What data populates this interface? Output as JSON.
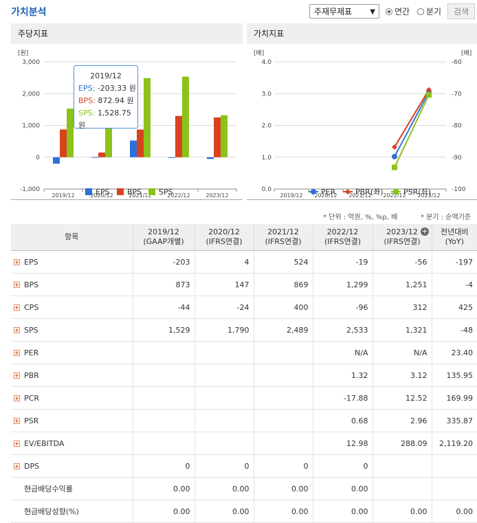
{
  "header": {
    "title": "가치분석",
    "select_value": "주재무제표",
    "radio_annual": "연간",
    "radio_quarter": "분기",
    "search_button": "검색"
  },
  "left_panel": {
    "title": "주당지표",
    "y_unit": "[원]",
    "tooltip": {
      "period": "2019/12",
      "eps_label": "EPS:",
      "eps_value": "-203.33 원",
      "bps_label": "BPS:",
      "bps_value": "872.94 원",
      "sps_label": "SPS:",
      "sps_value": "1,528.75 원"
    }
  },
  "right_panel": {
    "title": "가치지표",
    "y_unit_left": "[배]",
    "y_unit_right": "[배]"
  },
  "chart_data": [
    {
      "type": "bar",
      "title": "주당지표",
      "ylabel": "[원]",
      "categories": [
        "2019/12",
        "2020/12",
        "2021/12",
        "2022/12",
        "2023/12"
      ],
      "ylim": [
        -1000,
        3000
      ],
      "yticks": [
        "3,000",
        "2,000",
        "1,000",
        "0",
        "-1,000"
      ],
      "series": [
        {
          "name": "EPS",
          "color": "#2f6fd8",
          "values": [
            -203,
            4,
            524,
            -19,
            -56
          ]
        },
        {
          "name": "BPS",
          "color": "#d8431f",
          "values": [
            873,
            147,
            869,
            1299,
            1251
          ]
        },
        {
          "name": "SPS",
          "color": "#8cc21b",
          "values": [
            1529,
            1790,
            2489,
            2533,
            1321
          ]
        }
      ],
      "legend_position": "bottom"
    },
    {
      "type": "line",
      "title": "가치지표",
      "categories": [
        "2019/12",
        "2020/12",
        "2021/12",
        "2022/12",
        "2023/12"
      ],
      "ylim_left": [
        0,
        4
      ],
      "yticks_left": [
        "4.0",
        "3.0",
        "2.0",
        "1.0",
        "0.0"
      ],
      "ylim_right": [
        -100,
        -60
      ],
      "yticks_right": [
        "-60",
        "-70",
        "-80",
        "-90",
        "-100"
      ],
      "series": [
        {
          "name": "PER",
          "color": "#2f6fd8",
          "axis": "right",
          "values": [
            null,
            null,
            null,
            -89.8,
            -69.5
          ]
        },
        {
          "name": "PBR(좌)",
          "color": "#d8431f",
          "axis": "left",
          "values": [
            null,
            null,
            null,
            1.32,
            3.12
          ]
        },
        {
          "name": "PSR(좌)",
          "color": "#8cc21b",
          "axis": "left",
          "values": [
            null,
            null,
            null,
            0.68,
            2.96
          ]
        }
      ],
      "legend_position": "bottom"
    }
  ],
  "notes": {
    "unit": "* 단위 : 억원, %, %p, 배",
    "quarter": "* 분기 : 순액기준"
  },
  "table": {
    "headers": [
      {
        "line1": "항목",
        "line2": ""
      },
      {
        "line1": "2019/12",
        "line2": "(GAAP개별)"
      },
      {
        "line1": "2020/12",
        "line2": "(IFRS연결)"
      },
      {
        "line1": "2021/12",
        "line2": "(IFRS연결)"
      },
      {
        "line1": "2022/12",
        "line2": "(IFRS연결)"
      },
      {
        "line1": "2023/12",
        "line2": "(IFRS연결)"
      },
      {
        "line1": "전년대비",
        "line2": "(YoY)"
      }
    ],
    "rows": [
      {
        "label": "EPS",
        "expand": true,
        "cells": [
          "-203",
          "4",
          "524",
          "-19",
          "-56",
          "-197"
        ]
      },
      {
        "label": "BPS",
        "expand": true,
        "cells": [
          "873",
          "147",
          "869",
          "1,299",
          "1,251",
          "-4"
        ]
      },
      {
        "label": "CPS",
        "expand": true,
        "cells": [
          "-44",
          "-24",
          "400",
          "-96",
          "312",
          "425"
        ]
      },
      {
        "label": "SPS",
        "expand": true,
        "cells": [
          "1,529",
          "1,790",
          "2,489",
          "2,533",
          "1,321",
          "-48"
        ]
      },
      {
        "label": "PER",
        "expand": true,
        "cells": [
          "",
          "",
          "",
          "N/A",
          "N/A",
          "23.40"
        ]
      },
      {
        "label": "PBR",
        "expand": true,
        "cells": [
          "",
          "",
          "",
          "1.32",
          "3.12",
          "135.95"
        ]
      },
      {
        "label": "PCR",
        "expand": true,
        "cells": [
          "",
          "",
          "",
          "-17.88",
          "12.52",
          "169.99"
        ]
      },
      {
        "label": "PSR",
        "expand": true,
        "cells": [
          "",
          "",
          "",
          "0.68",
          "2.96",
          "335.87"
        ]
      },
      {
        "label": "EV/EBITDA",
        "expand": true,
        "cells": [
          "",
          "",
          "",
          "12.98",
          "288.09",
          "2,119.20"
        ]
      },
      {
        "label": "DPS",
        "expand": true,
        "cells": [
          "0",
          "0",
          "0",
          "0",
          "",
          ""
        ]
      },
      {
        "label": "현금배당수익률",
        "expand": false,
        "cells": [
          "0.00",
          "0.00",
          "0.00",
          "0.00",
          "",
          ""
        ]
      },
      {
        "label": "현금배당성향(%)",
        "expand": false,
        "cells": [
          "0.00",
          "0.00",
          "0.00",
          "0.00",
          "0.00",
          "0.00"
        ]
      }
    ]
  }
}
